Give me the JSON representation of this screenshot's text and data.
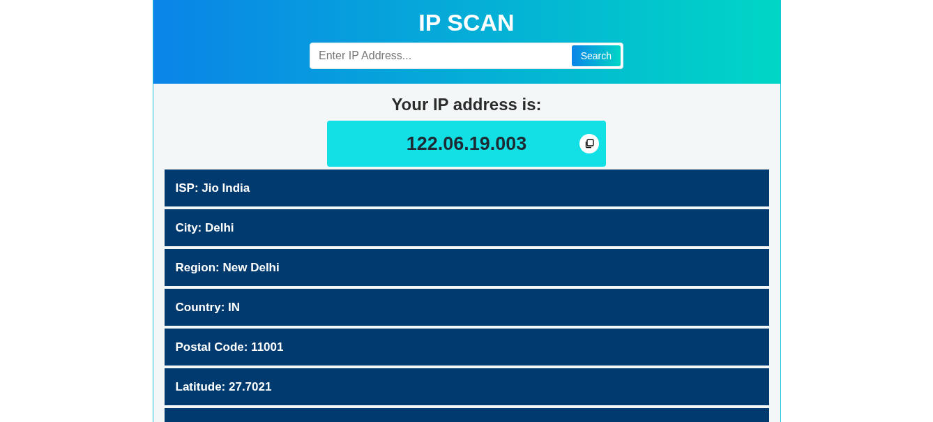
{
  "header": {
    "title": "IP SCAN",
    "search": {
      "placeholder": "Enter IP Address...",
      "button": "Search"
    }
  },
  "ip_panel": {
    "heading": "Your IP address is:",
    "ip": "122.06.19.003"
  },
  "info_rows": [
    {
      "kind": "text",
      "text": "ISP: Jio India"
    },
    {
      "kind": "text",
      "text": "City: Delhi"
    },
    {
      "kind": "text",
      "text": "Region: New Delhi"
    },
    {
      "kind": "text",
      "text": "Country: IN"
    },
    {
      "kind": "text",
      "text": "Postal Code: 11001"
    },
    {
      "kind": "text",
      "text": "Latitude: 27.7021"
    },
    {
      "kind": "cut-off"
    }
  ]
}
